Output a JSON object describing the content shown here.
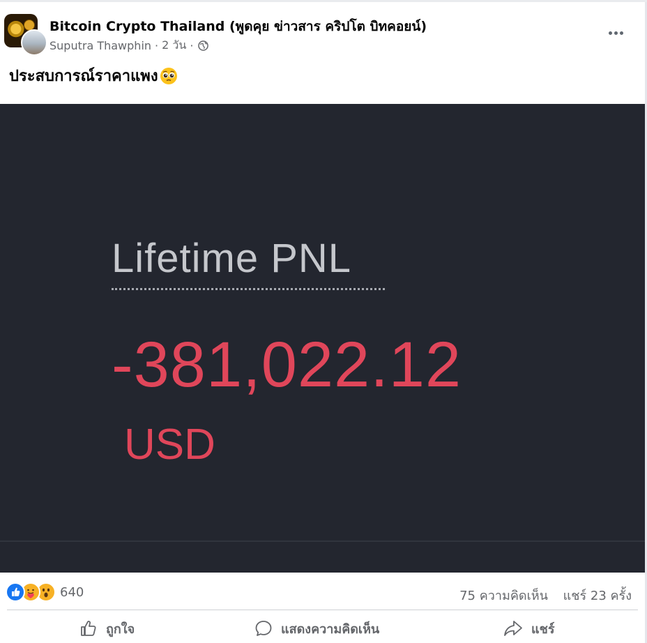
{
  "post": {
    "group_name": "Bitcoin Crypto Thailand (พูดคุย ข่าวสาร คริปโต บิทคอยน์)",
    "author": "Suputra Thawphin",
    "time": "2 วัน",
    "separator": "·",
    "privacy_icon": "globe-icon",
    "text": "ประสบการณ์ราคาแพง",
    "emoji": "pleading-face-emoji"
  },
  "image": {
    "label": "Lifetime PNL",
    "value": "-381,022.12",
    "currency": "USD",
    "colors": {
      "background": "#23262f",
      "value": "#e0465a",
      "label": "#c5c7cc"
    }
  },
  "reactions": {
    "icons": [
      "like-icon",
      "care-icon",
      "wow-icon"
    ],
    "count": "640"
  },
  "stats": {
    "comments": "75 ความคิดเห็น",
    "shares": "แชร์ 23 ครั้ง"
  },
  "actions": {
    "like": "ถูกใจ",
    "comment": "แสดงความคิดเห็น",
    "share": "แชร์"
  }
}
